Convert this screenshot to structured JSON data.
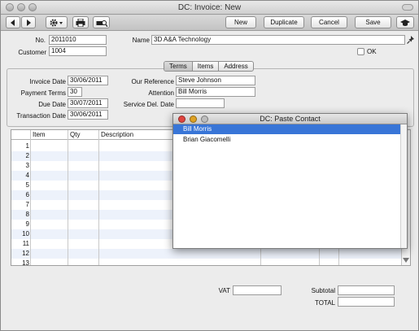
{
  "window": {
    "title": "DC: Invoice: New"
  },
  "toolbar": {
    "new_label": "New",
    "duplicate_label": "Duplicate",
    "cancel_label": "Cancel",
    "save_label": "Save"
  },
  "header": {
    "no_label": "No.",
    "no_value": "2011010",
    "name_label": "Name",
    "name_value": "3D A&A Technology",
    "customer_label": "Customer",
    "customer_value": "1004",
    "ok_label": "OK"
  },
  "tabs": [
    {
      "label": "Terms",
      "selected": true
    },
    {
      "label": "Items",
      "selected": false
    },
    {
      "label": "Address",
      "selected": false
    }
  ],
  "terms": {
    "invoice_date_label": "Invoice Date",
    "invoice_date_value": "30/06/2011",
    "payment_terms_label": "Payment Terms",
    "payment_terms_value": "30",
    "due_date_label": "Due Date",
    "due_date_value": "30/07/2011",
    "transaction_date_label": "Transaction Date",
    "transaction_date_value": "30/06/2011",
    "our_reference_label": "Our Reference",
    "our_reference_value": "Steve Johnson",
    "attention_label": "Attention",
    "attention_value": "Bill Morris",
    "service_del_date_label": "Service Del. Date",
    "service_del_date_value": ""
  },
  "grid": {
    "columns": [
      "Item",
      "Qty",
      "Description"
    ],
    "row_numbers": [
      "1",
      "2",
      "3",
      "4",
      "5",
      "6",
      "7",
      "8",
      "9",
      "10",
      "11",
      "12",
      "13"
    ]
  },
  "totals": {
    "vat_label": "VAT",
    "vat_value": "",
    "subtotal_label": "Subtotal",
    "subtotal_value": "",
    "total_label": "TOTAL",
    "total_value": ""
  },
  "popup": {
    "title": "DC: Paste Contact",
    "items": [
      "Bill Morris",
      "Brian Giacomelli"
    ],
    "selected_index": 0
  },
  "colors": {
    "selection": "#3875d7",
    "close_button": "#e0443e",
    "minimize_button": "#dea123"
  }
}
